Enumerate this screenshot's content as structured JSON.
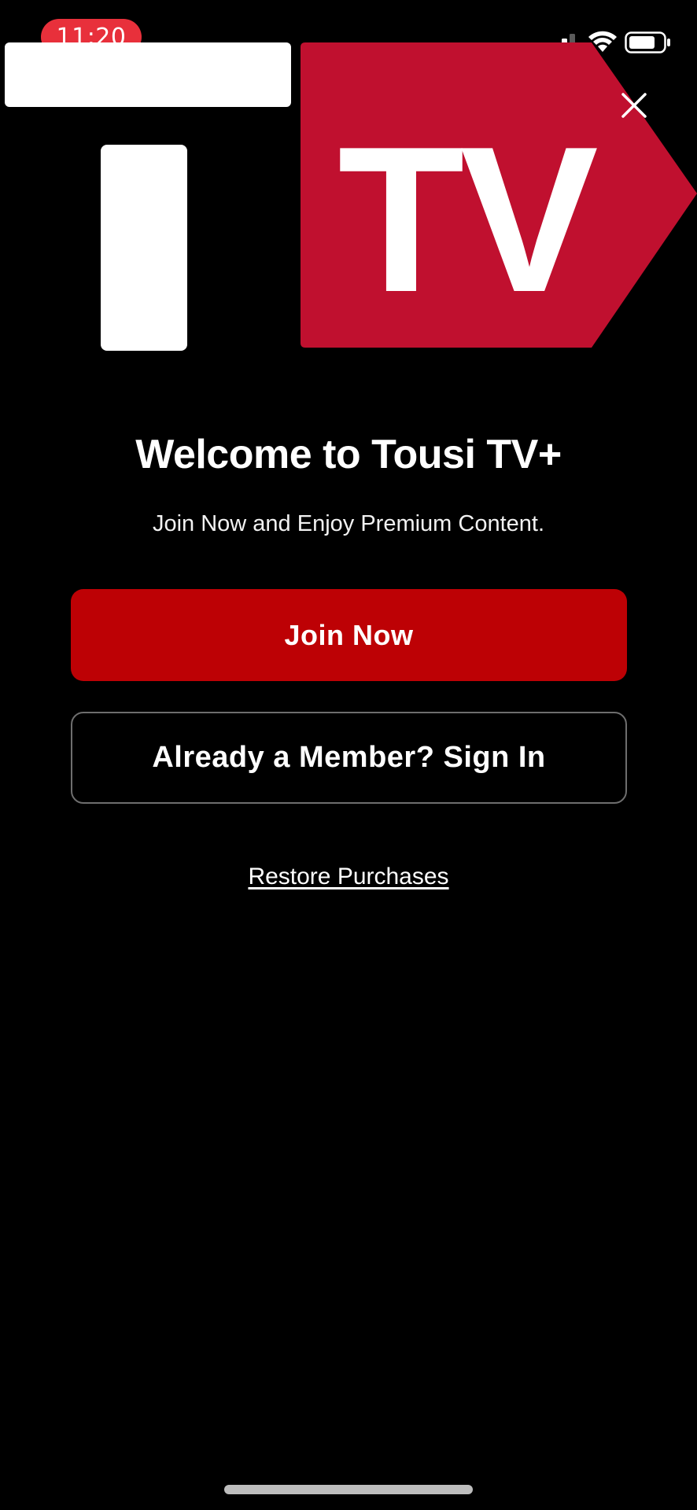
{
  "status_bar": {
    "time": "11:20",
    "time_pill_color": "#e8303b",
    "icons": [
      "cellular-signal-icon",
      "wifi-icon",
      "battery-icon"
    ]
  },
  "logo": {
    "text": "TV",
    "brand_color": "#c0102f"
  },
  "close": {
    "icon": "close-icon"
  },
  "welcome": {
    "title": "Welcome to Tousi TV+",
    "subtitle": "Join Now and Enjoy Premium Content."
  },
  "actions": {
    "join_label": "Join Now",
    "join_color": "#bd0105",
    "signin_label": "Already a Member? Sign In",
    "restore_label": "Restore Purchases"
  }
}
